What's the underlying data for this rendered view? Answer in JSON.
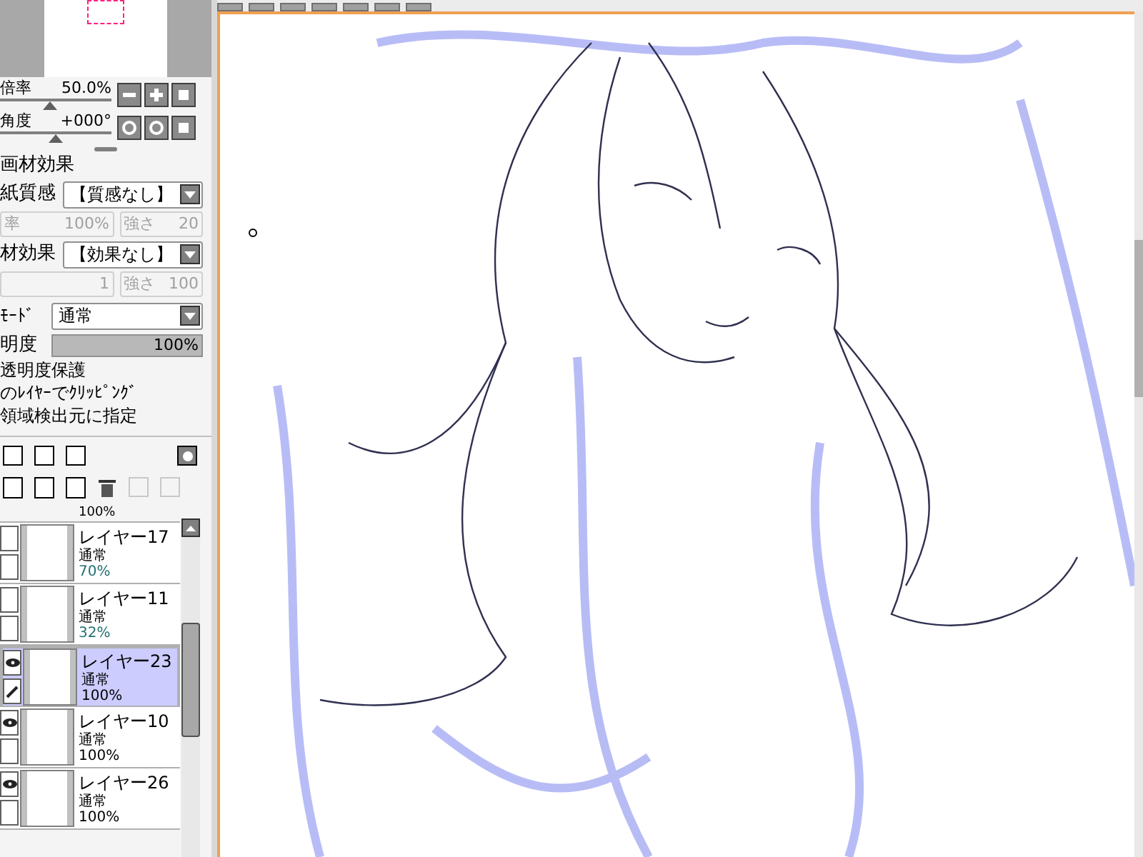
{
  "navigator": {
    "zoom_label": "倍率",
    "zoom_value": "50.0%",
    "zoom_slider": {
      "level": 0.45
    },
    "angle_label": "角度",
    "angle_value": "+000°",
    "angle_slider": {
      "level": 0.5
    }
  },
  "texture": {
    "heading": "画材効果",
    "paper_label": "紙質感",
    "paper_value": "【質感なし】",
    "paper_scale_label": "率",
    "paper_scale": "100%",
    "paper_strength_label": "強さ",
    "paper_strength": "20",
    "effect_label": "材効果",
    "effect_value": "【効果なし】",
    "effect_scale": "1",
    "effect_strength_label": "強さ",
    "effect_strength": "100"
  },
  "blend": {
    "mode_label": "ﾓｰﾄﾞ",
    "mode_value": "通常",
    "opacity_label": "明度",
    "opacity_value": "100%",
    "opacity_slider": {
      "level": 1
    }
  },
  "options": [
    {
      "label": "透明度保護",
      "checked": false
    },
    {
      "label": "のﾚｲﾔｰでｸﾘｯﾋﾟﾝｸﾞ",
      "checked": false
    },
    {
      "label": "領域検出元に指定",
      "checked": false
    }
  ],
  "layers_top_partial": "100%",
  "layers": [
    {
      "name": "レイヤー17",
      "mode": "通常",
      "opacity": "70%",
      "visible": false,
      "selected": false,
      "dimmed": true
    },
    {
      "name": "レイヤー11",
      "mode": "通常",
      "opacity": "32%",
      "visible": false,
      "selected": false,
      "dimmed": true
    },
    {
      "name": "レイヤー23",
      "mode": "通常",
      "opacity": "100%",
      "visible": true,
      "selected": true,
      "dimmed": false
    },
    {
      "name": "レイヤー10",
      "mode": "通常",
      "opacity": "100%",
      "visible": true,
      "selected": false,
      "dimmed": false
    },
    {
      "name": "レイヤー26",
      "mode": "通常",
      "opacity": "100%",
      "visible": true,
      "selected": false,
      "dimmed": false
    }
  ]
}
